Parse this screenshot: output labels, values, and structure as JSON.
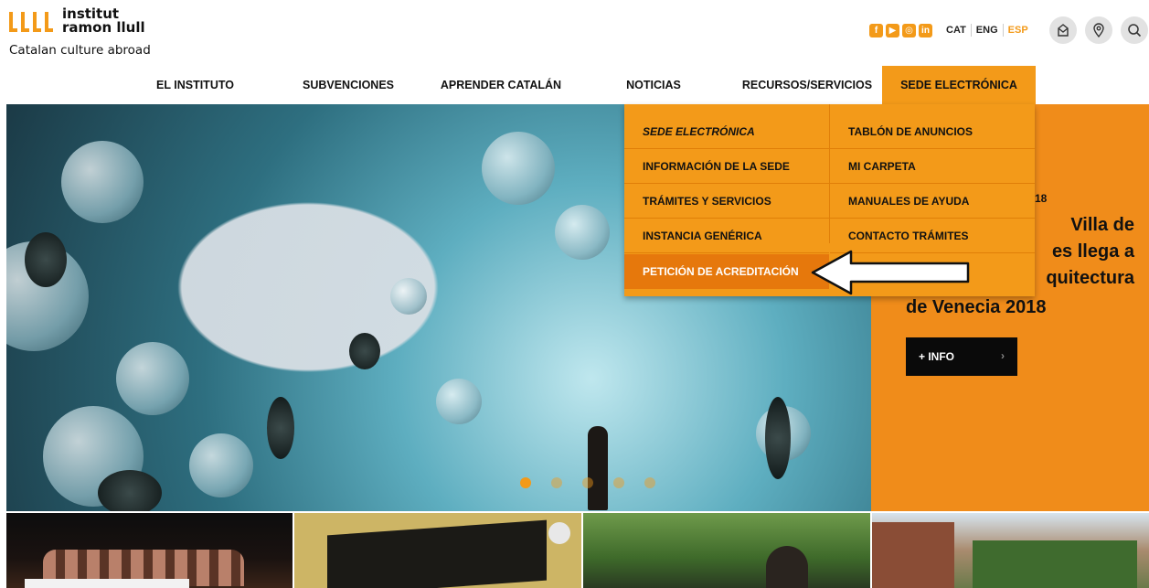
{
  "brand": {
    "name_line1": "institut",
    "name_line2": "ramon llull",
    "tagline": "Catalan culture abroad",
    "accent_color": "#f39a19"
  },
  "social": [
    {
      "icon": "facebook-icon",
      "glyph": "f"
    },
    {
      "icon": "youtube-icon",
      "glyph": "▶"
    },
    {
      "icon": "instagram-icon",
      "glyph": "◎"
    },
    {
      "icon": "linkedin-icon",
      "glyph": "in"
    }
  ],
  "languages": [
    {
      "label": "CAT",
      "active": false
    },
    {
      "label": "ENG",
      "active": false
    },
    {
      "label": "ESP",
      "active": true
    }
  ],
  "tools": [
    {
      "icon": "mailbox-icon"
    },
    {
      "icon": "location-icon"
    },
    {
      "icon": "search-icon"
    }
  ],
  "nav": [
    {
      "label": "EL INSTITUTO"
    },
    {
      "label": "SUBVENCIONES"
    },
    {
      "label": "APRENDER CATALÁN"
    },
    {
      "label": "NOTICIAS"
    },
    {
      "label": "RECURSOS/SERVICIOS"
    },
    {
      "label": "SEDE ELECTRÓNICA",
      "active": true
    }
  ],
  "dropdown": {
    "left_column": [
      {
        "label": "SEDE ELECTRÓNICA"
      },
      {
        "label": "INFORMACIÓN DE LA SEDE"
      },
      {
        "label": "TRÁMITES Y SERVICIOS"
      },
      {
        "label": "INSTANCIA GENÉRICA"
      },
      {
        "label": "PETICIÓN DE ACREDITACIÓN"
      }
    ],
    "right_column": [
      {
        "label": "TABLÓN DE ANUNCIOS"
      },
      {
        "label": "MI CARPETA"
      },
      {
        "label": "MANUALES DE AYUDA"
      },
      {
        "label": "CONTACTO TRÁMITES"
      }
    ]
  },
  "feature": {
    "date_fragment": "18",
    "title_lines": [
      "Villa de",
      "es llega a",
      "quitectura"
    ],
    "title_last": "de Venecia 2018",
    "button_label": "+ INFO",
    "button_chevron": "›"
  },
  "slider": {
    "dots": 5,
    "active_index": 0
  }
}
